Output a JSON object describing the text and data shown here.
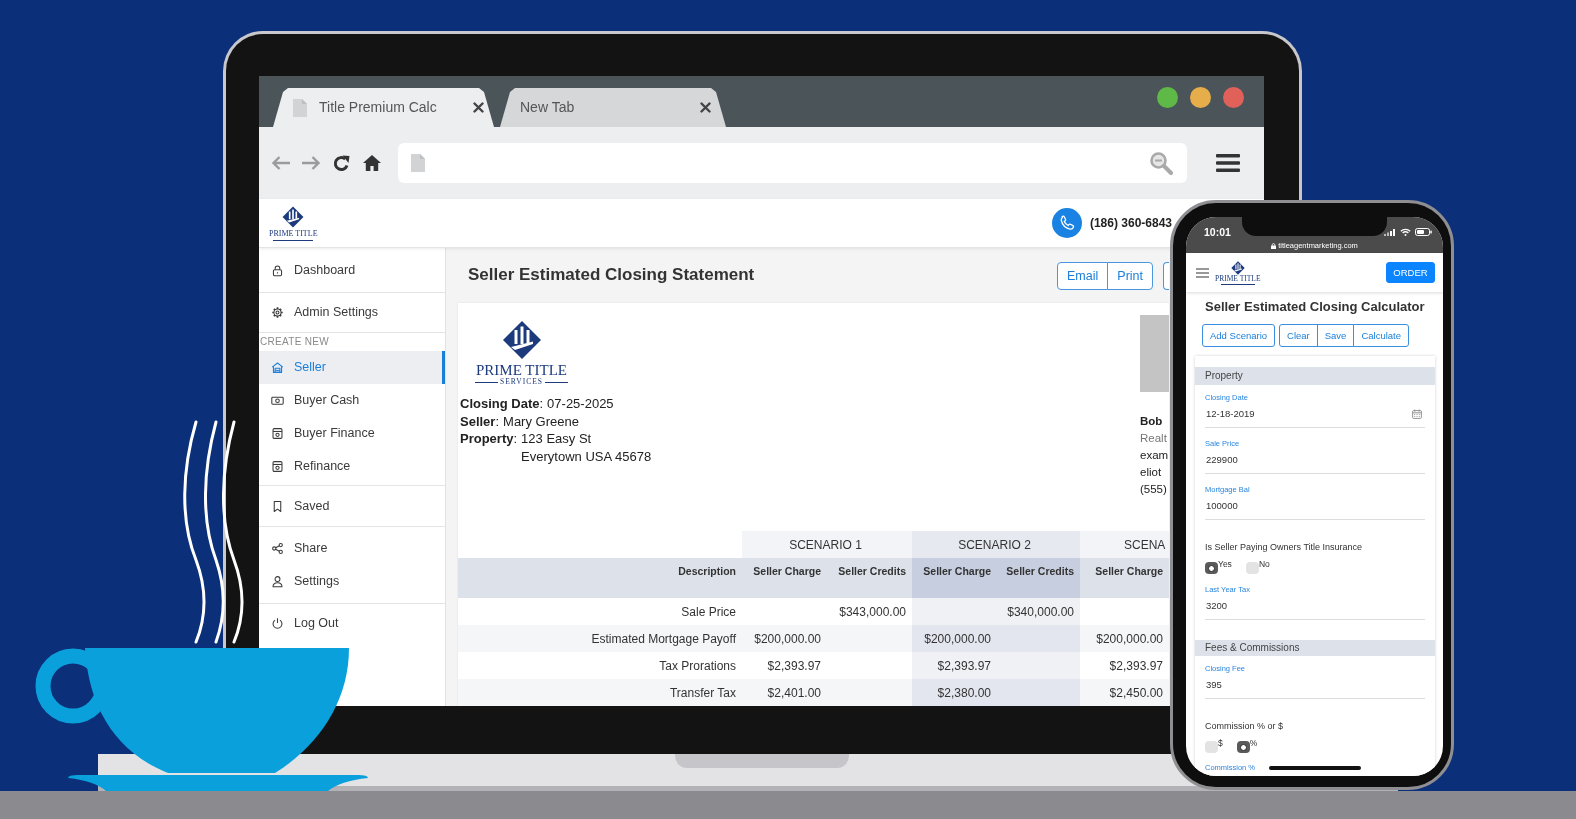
{
  "browser": {
    "tabs": [
      {
        "title": "Title Premium Calc",
        "selected": true
      },
      {
        "title": "New Tab",
        "selected": false
      }
    ]
  },
  "site_header": {
    "logo": {
      "name": "PRIME TITLE"
    },
    "phone": "(186) 360-6843"
  },
  "sidebar": {
    "sections": [
      {
        "items": [
          {
            "label": "Dashboard",
            "selected": false
          }
        ]
      },
      {
        "items": [
          {
            "label": "Admin Settings",
            "selected": false
          }
        ]
      },
      {
        "heading": "CREATE NEW",
        "items": [
          {
            "label": "Seller",
            "selected": true
          },
          {
            "label": "Buyer Cash",
            "selected": false
          },
          {
            "label": "Buyer Finance",
            "selected": false
          },
          {
            "label": "Refinance",
            "selected": false
          }
        ]
      },
      {
        "items": [
          {
            "label": "Saved",
            "selected": false
          }
        ]
      },
      {
        "items": [
          {
            "label": "Share",
            "selected": false
          },
          {
            "label": "Settings",
            "selected": false
          }
        ]
      },
      {
        "items": [
          {
            "label": "Log Out",
            "selected": false
          }
        ]
      }
    ]
  },
  "main": {
    "title": "Seller Estimated Closing Statement",
    "actions": [
      "Email",
      "Print"
    ],
    "statement": {
      "logo": {
        "name": "PRIME TITLE",
        "tagline": "SERVICES"
      },
      "details": [
        {
          "label": "**Closing Date**:",
          "lines": [
            "07-25-2025"
          ]
        },
        {
          "label": "**Seller**:",
          "lines": [
            "Mary Greene"
          ]
        },
        {
          "label": "**Property**:",
          "lines": [
            "123 Easy St",
            "Everytown USA 45678"
          ]
        }
      ],
      "agent": {
        "name": "Bob",
        "role": "Realt",
        "contact": [
          "exam",
          "eliot",
          "(555)"
        ]
      }
    },
    "table": {
      "scenarios": [
        "SCENARIO 1",
        "SCENARIO 2",
        "SCENA"
      ],
      "columns": [
        "Description",
        "Seller Charge",
        "Seller Credits",
        "Seller Charge",
        "Seller Credits",
        "Seller Charge"
      ],
      "rows": [
        [
          "Sale Price",
          null,
          "$343,000.00",
          null,
          "$340,000.00",
          null
        ],
        [
          "Estimated Mortgage Payoff",
          "$200,000.00",
          null,
          "$200,000.00",
          null,
          "$200,000.00"
        ],
        [
          "Tax Prorations",
          "$2,393.97",
          null,
          "$2,393.97",
          null,
          "$2,393.97"
        ],
        [
          "Transfer Tax",
          "$2,401.00",
          null,
          "$2,380.00",
          null,
          "$2,450.00"
        ]
      ]
    }
  },
  "phone": {
    "time": "10:01",
    "url": "titleagentmarketing.com",
    "logo": {
      "name": "PRIME TITLE"
    },
    "order_button": "ORDER",
    "title": "Seller Estimated Closing Calculator",
    "buttons": [
      "Add Scenario"
    ],
    "button_group": [
      "Clear",
      "Save",
      "Calculate"
    ],
    "sections": [
      {
        "heading": "Property",
        "fields": [
          {
            "kind": "date",
            "label": "Closing Date",
            "value": "12-18-2019"
          },
          {
            "kind": "text",
            "label": "Sale Price",
            "value": "229900"
          },
          {
            "kind": "text",
            "label": "Mortgage Bal",
            "value": "100000"
          },
          {
            "kind": "radio",
            "label": "Is Seller Paying Owners Title Insurance",
            "options": [
              {
                "label": "Yes",
                "selected": true
              },
              {
                "label": "No",
                "selected": false
              }
            ]
          },
          {
            "kind": "text",
            "label": "Last Year Tax",
            "value": "3200"
          }
        ]
      },
      {
        "heading": "Fees & Commissions",
        "fields": [
          {
            "kind": "text",
            "label": "Closing Fee",
            "value": "395"
          },
          {
            "kind": "radio",
            "label": "Commission % or $",
            "options": [
              {
                "label": "$",
                "selected": false
              },
              {
                "label": "%",
                "selected": true
              }
            ]
          },
          {
            "kind": "text",
            "label": "Commission %"
          }
        ]
      }
    ]
  }
}
